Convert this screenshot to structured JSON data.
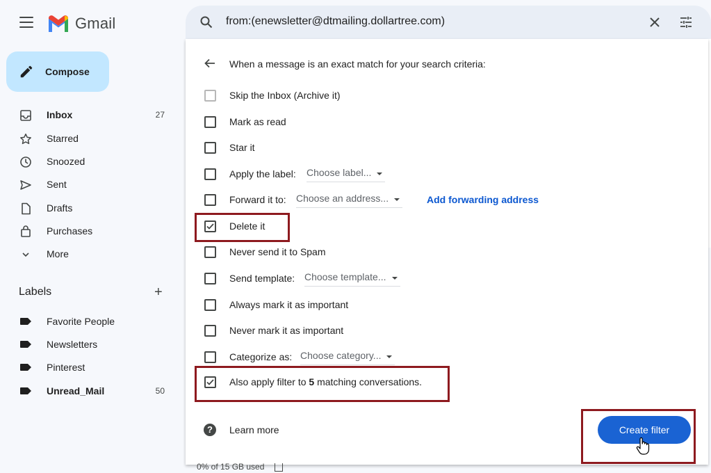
{
  "app": {
    "name": "Gmail"
  },
  "compose_label": "Compose",
  "nav": [
    {
      "label": "Inbox",
      "count": "27",
      "bold": true
    },
    {
      "label": "Starred",
      "count": ""
    },
    {
      "label": "Snoozed",
      "count": ""
    },
    {
      "label": "Sent",
      "count": ""
    },
    {
      "label": "Drafts",
      "count": ""
    },
    {
      "label": "Purchases",
      "count": ""
    },
    {
      "label": "More",
      "count": ""
    }
  ],
  "labels": {
    "heading": "Labels",
    "add": "+",
    "items": [
      {
        "label": "Favorite People",
        "count": ""
      },
      {
        "label": "Newsletters",
        "count": ""
      },
      {
        "label": "Pinterest",
        "count": ""
      },
      {
        "label": "Unread_Mail",
        "count": "50"
      }
    ]
  },
  "search": {
    "value": "from:(enewsletter@dtmailing.dollartree.com)"
  },
  "filter": {
    "title": "When a message is an exact match for your search criteria:",
    "options": [
      {
        "label": "Skip the Inbox (Archive it)",
        "checked": false
      },
      {
        "label": "Mark as read",
        "checked": false
      },
      {
        "label": "Star it",
        "checked": false
      },
      {
        "label": "Apply the label:",
        "dropdown": "Choose label...",
        "checked": false
      },
      {
        "label": "Forward it to:",
        "dropdown": "Choose an address...",
        "link": "Add forwarding address",
        "checked": false
      },
      {
        "label": "Delete it",
        "checked": true
      },
      {
        "label": "Never send it to Spam",
        "checked": false
      },
      {
        "label": "Send template:",
        "dropdown": "Choose template...",
        "checked": false
      },
      {
        "label": "Always mark it as important",
        "checked": false
      },
      {
        "label": "Never mark it as important",
        "checked": false
      },
      {
        "label": "Categorize as:",
        "dropdown": "Choose category...",
        "checked": false
      }
    ],
    "apply_existing": {
      "prefix": "Also apply filter to ",
      "count": "5",
      "suffix": " matching conversations.",
      "checked": true
    },
    "help_glyph": "?",
    "learn_more": "Learn more",
    "create_button": "Create filter"
  },
  "footer": {
    "storage": "0% of 15 GB used"
  },
  "colors": {
    "accent": "#1a63d3",
    "compose_bg": "#c2e7ff",
    "highlight": "#8e1a1f",
    "link": "#0b57d0"
  }
}
